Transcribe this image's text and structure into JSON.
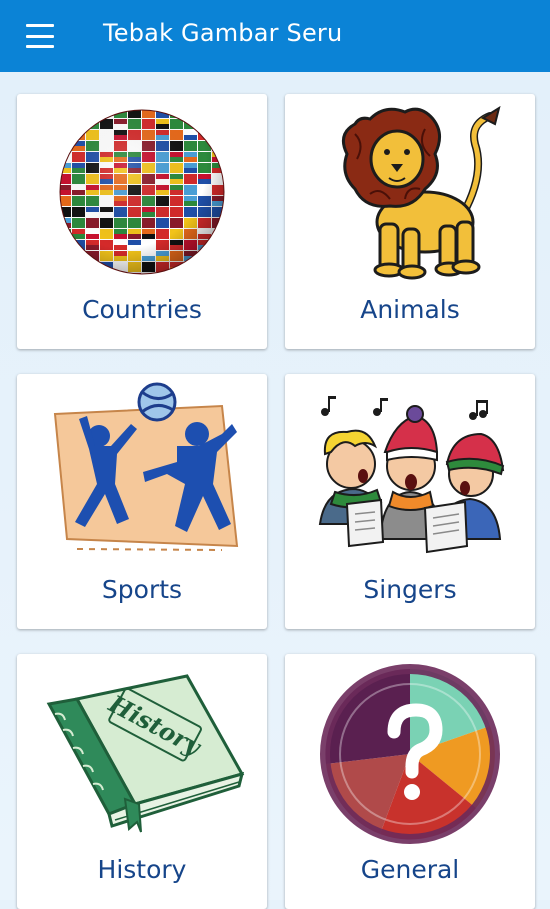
{
  "app": {
    "title": "Tebak Gambar Seru"
  },
  "icons": {
    "menu": "hamburger-menu-icon"
  },
  "colors": {
    "appbar": "#0b83d6",
    "label": "#16458a",
    "background": "#e6f2fb"
  },
  "categories": [
    {
      "label": "Countries",
      "icon": "globe-flags-icon"
    },
    {
      "label": "Animals",
      "icon": "lion-icon"
    },
    {
      "label": "Sports",
      "icon": "players-ball-icon"
    },
    {
      "label": "Singers",
      "icon": "carol-singers-icon"
    },
    {
      "label": "History",
      "icon": "history-book-icon"
    },
    {
      "label": "General",
      "icon": "question-wheel-icon"
    }
  ],
  "history_book_text": "History"
}
